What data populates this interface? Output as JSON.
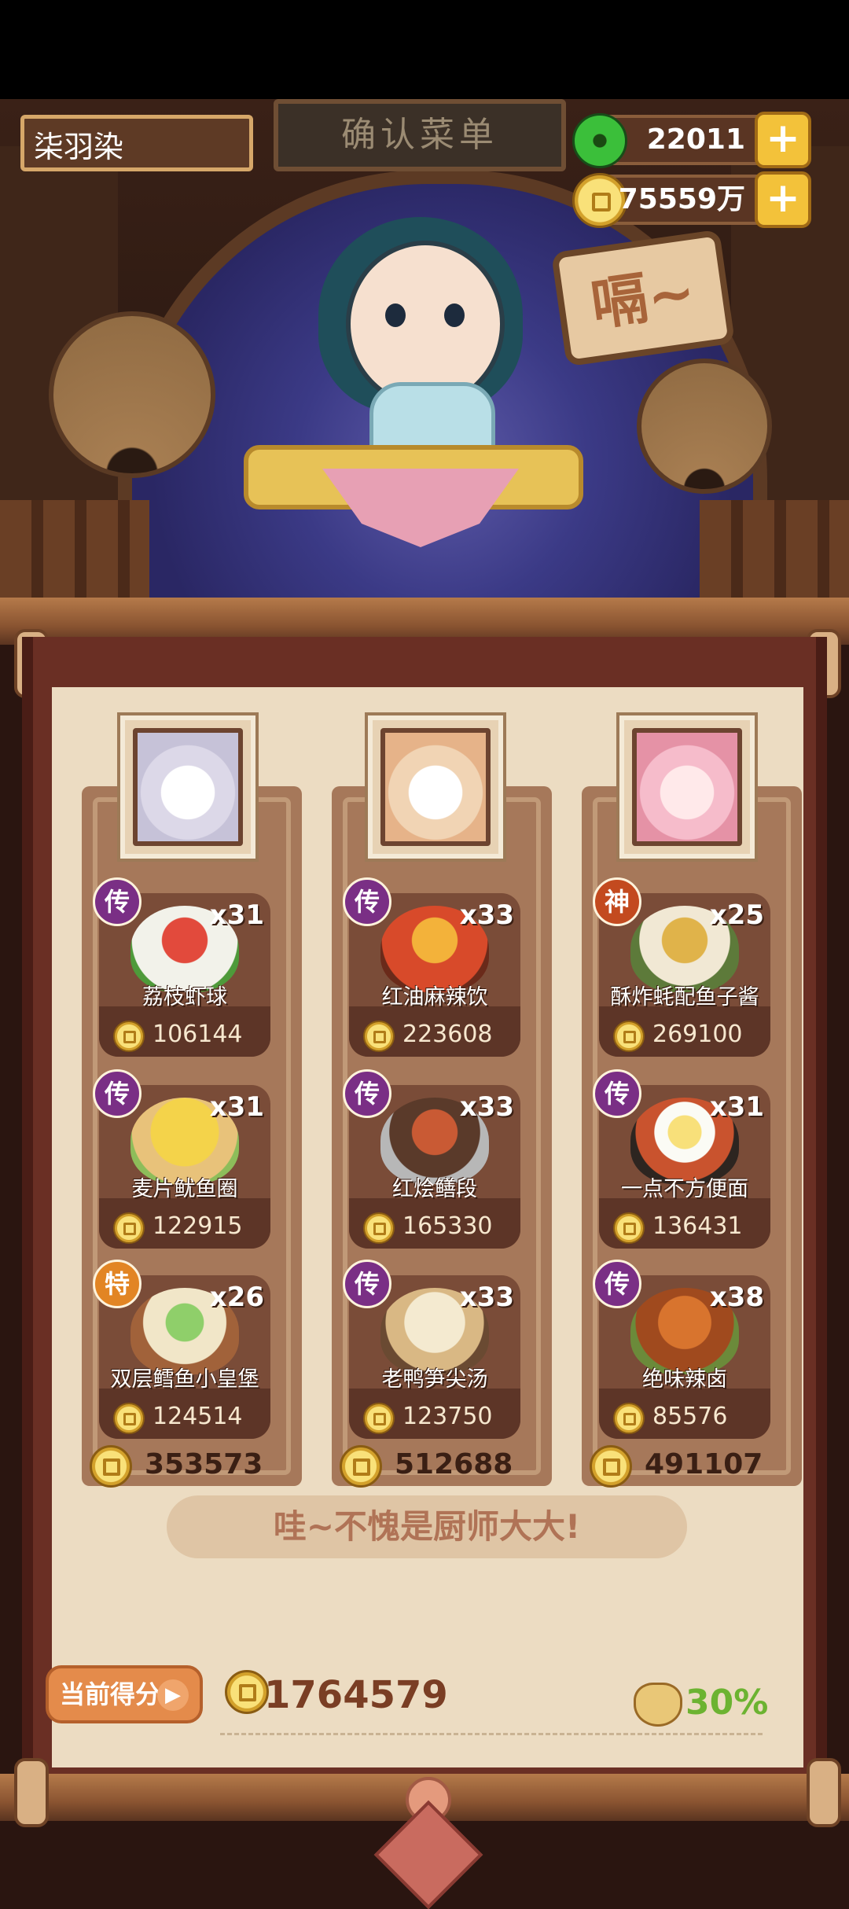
{
  "header": {
    "player_name": "柒羽染",
    "sign_text": "确认菜单",
    "jade_amount": "22011",
    "coin_amount": "75559万",
    "speech": "嗝~"
  },
  "customers": [
    {
      "portrait": "silver-hair-girl-portrait",
      "dishes": [
        {
          "badge": "传",
          "qty": "x31",
          "name": "荔枝虾球",
          "price": "106144"
        },
        {
          "badge": "传",
          "qty": "x31",
          "name": "麦片鱿鱼圈",
          "price": "122915"
        },
        {
          "badge": "特",
          "qty": "x26",
          "name": "双层鳕鱼小皇堡",
          "price": "124514"
        }
      ],
      "total": "353573"
    },
    {
      "portrait": "lion-dance-boy-portrait",
      "dishes": [
        {
          "badge": "传",
          "qty": "x33",
          "name": "红油麻辣饮",
          "price": "223608"
        },
        {
          "badge": "传",
          "qty": "x33",
          "name": "红烩鳝段",
          "price": "165330"
        },
        {
          "badge": "传",
          "qty": "x33",
          "name": "老鸭笋尖汤",
          "price": "123750"
        }
      ],
      "total": "512688"
    },
    {
      "portrait": "pink-hair-girl-portrait",
      "dishes": [
        {
          "badge": "神",
          "qty": "x25",
          "name": "酥炸蚝配鱼子酱",
          "price": "269100"
        },
        {
          "badge": "传",
          "qty": "x31",
          "name": "一点不方便面",
          "price": "136431"
        },
        {
          "badge": "传",
          "qty": "x38",
          "name": "绝味辣卤",
          "price": "85576"
        }
      ],
      "total": "491107"
    }
  ],
  "praise": "哇~不愧是厨师大大!",
  "score": {
    "button_label": "当前得分",
    "value": "1764579",
    "bonus_percent": "30%"
  },
  "colors": {
    "legend_badge": "#7a2f85",
    "god_badge": "#c34a1f",
    "special_badge": "#e28524",
    "bonus_green": "#6cb331"
  }
}
